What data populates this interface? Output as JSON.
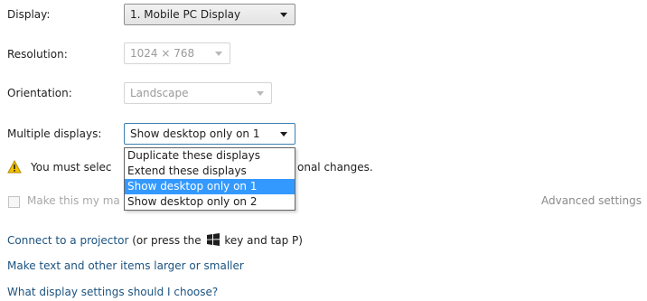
{
  "display": {
    "label": "Display:",
    "value": "1. Mobile PC Display"
  },
  "resolution": {
    "label": "Resolution:",
    "value": "1024 × 768"
  },
  "orientation": {
    "label": "Orientation:",
    "value": "Landscape"
  },
  "multiple_displays": {
    "label": "Multiple displays:",
    "value": "Show desktop only on 1",
    "options": [
      "Duplicate these displays",
      "Extend these displays",
      "Show desktop only on 1",
      "Show desktop only on 2"
    ],
    "selected_option": "Show desktop only on 1"
  },
  "warning": {
    "text_left": "You must selec",
    "text_right": "onal changes."
  },
  "primary_checkbox": {
    "label": "Make this my ma"
  },
  "advanced_settings": "Advanced settings",
  "links": {
    "connect_projector": "Connect to a projector",
    "projector_hint_prefix": "(or press the",
    "projector_hint_suffix": "key and tap P)",
    "text_size": "Make text and other items larger or smaller",
    "help": "What display settings should I choose?"
  },
  "colors": {
    "link": "#1c5380",
    "selection": "#3399ff",
    "warning": "#f2c200"
  }
}
